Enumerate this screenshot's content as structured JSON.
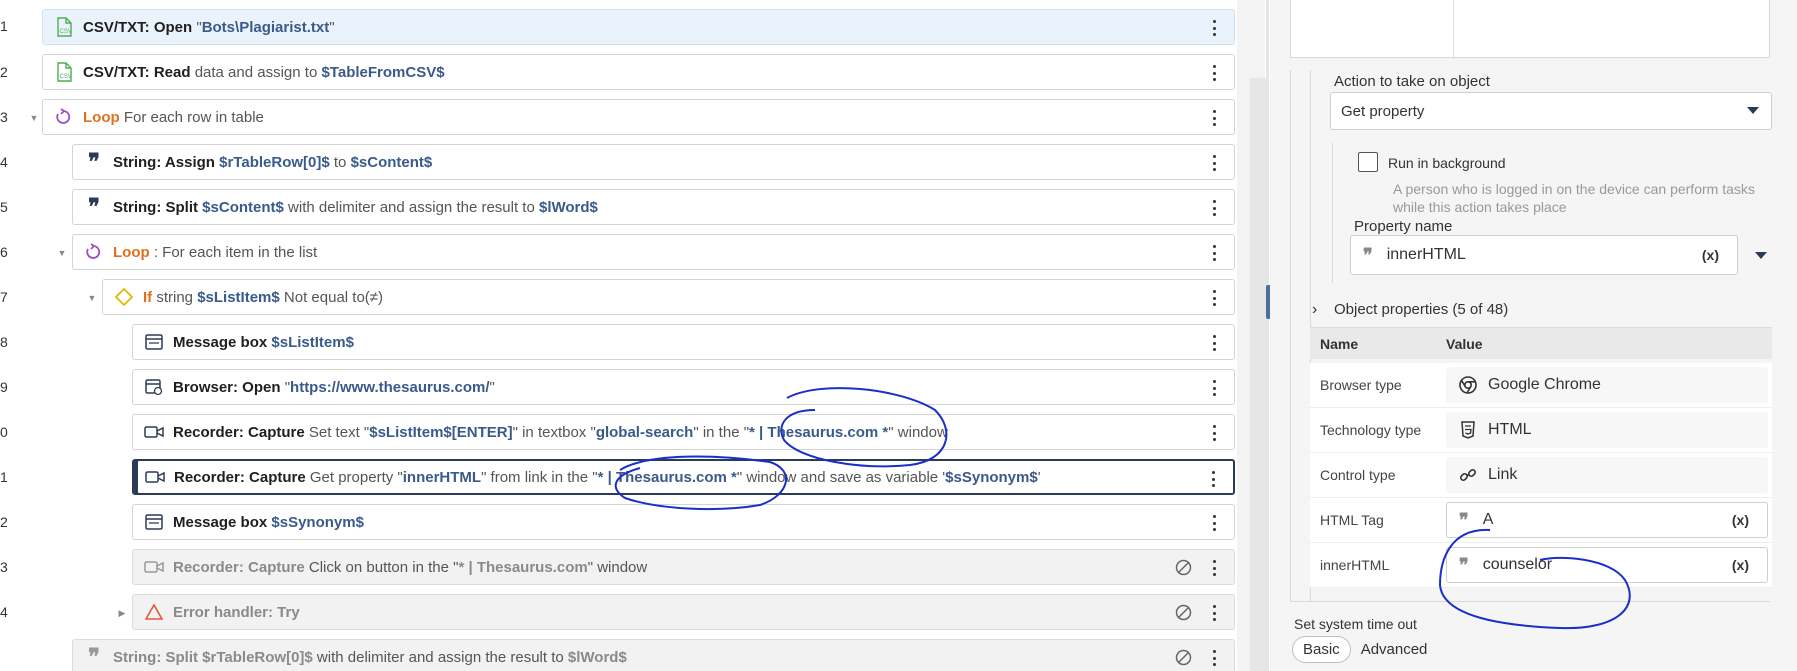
{
  "steps": [
    {
      "num": "1",
      "parts": [
        [
          "b",
          "CSV/TXT: Open"
        ],
        [
          "n",
          " \""
        ],
        [
          "v",
          "Bots\\Plagiarist.txt"
        ],
        [
          "n",
          "\""
        ]
      ]
    },
    {
      "num": "2",
      "parts": [
        [
          "b",
          "CSV/TXT: Read"
        ],
        [
          "n",
          " data and assign to "
        ],
        [
          "v",
          "$TableFromCSV$"
        ]
      ]
    },
    {
      "num": "3",
      "parts": [
        [
          "o",
          "Loop"
        ],
        [
          "n",
          " For each row in table"
        ]
      ]
    },
    {
      "num": "4",
      "parts": [
        [
          "b",
          "String: Assign"
        ],
        [
          "n",
          " "
        ],
        [
          "v",
          "$rTableRow[0]$"
        ],
        [
          "n",
          " to "
        ],
        [
          "v",
          "$sContent$"
        ]
      ]
    },
    {
      "num": "5",
      "parts": [
        [
          "b",
          "String: Split"
        ],
        [
          "n",
          " "
        ],
        [
          "v",
          "$sContent$"
        ],
        [
          "n",
          " with delimiter and assign the result to "
        ],
        [
          "v",
          "$lWord$"
        ]
      ]
    },
    {
      "num": "6",
      "parts": [
        [
          "o",
          "Loop"
        ],
        [
          "n",
          " : For each item in the list"
        ]
      ]
    },
    {
      "num": "7",
      "parts": [
        [
          "o",
          "If"
        ],
        [
          "n",
          " string "
        ],
        [
          "v",
          "$sListItem$"
        ],
        [
          "n",
          " Not equal to(≠)"
        ]
      ]
    },
    {
      "num": "8",
      "parts": [
        [
          "b",
          "Message box"
        ],
        [
          "n",
          " "
        ],
        [
          "v",
          "$sListItem$"
        ]
      ]
    },
    {
      "num": "9",
      "parts": [
        [
          "b",
          "Browser: Open"
        ],
        [
          "n",
          " \""
        ],
        [
          "v",
          "https://www.thesaurus.com/"
        ],
        [
          "n",
          "\""
        ]
      ]
    },
    {
      "num": "0",
      "parts": [
        [
          "b",
          "Recorder: Capture"
        ],
        [
          "n",
          " Set text \""
        ],
        [
          "v",
          "$sListItem$[ENTER]"
        ],
        [
          "n",
          "\" in textbox \""
        ],
        [
          "v",
          "global-search"
        ],
        [
          "n",
          "\" in the \""
        ],
        [
          "v",
          "* | Thesaurus.com *"
        ],
        [
          "n",
          "\" window"
        ]
      ]
    },
    {
      "num": "1",
      "parts": [
        [
          "b",
          "Recorder: Capture"
        ],
        [
          "n",
          " Get property \""
        ],
        [
          "v",
          "innerHTML"
        ],
        [
          "n",
          "\" from link in the \""
        ],
        [
          "v",
          "* | Thesaurus.com *"
        ],
        [
          "n",
          "\" window and save as variable '"
        ],
        [
          "v",
          "$sSynonym$"
        ],
        [
          "n",
          "'"
        ]
      ]
    },
    {
      "num": "2",
      "parts": [
        [
          "b",
          "Message box"
        ],
        [
          "n",
          " "
        ],
        [
          "v",
          "$sSynonym$"
        ]
      ]
    },
    {
      "num": "3",
      "parts": [
        [
          "b",
          "Recorder: Capture"
        ],
        [
          "n",
          " Click on button in the \""
        ],
        [
          "v",
          "* | Thesaurus.com"
        ],
        [
          "n",
          "\" window"
        ]
      ]
    },
    {
      "num": "4",
      "parts": [
        [
          "b",
          "Error handler: Try"
        ]
      ]
    },
    {
      "num": "",
      "parts": [
        [
          "b",
          "String: Split"
        ],
        [
          "n",
          " "
        ],
        [
          "v",
          "$rTableRow[0]$"
        ],
        [
          "n",
          " with delimiter and assign the result to "
        ],
        [
          "v",
          "$lWord$"
        ]
      ]
    }
  ],
  "props": {
    "action_label": "Action to take on object",
    "action_value": "Get property",
    "run_bg_label": "Run in background",
    "run_bg_desc": "A person who is logged in on the device can perform tasks while this action takes place",
    "property_name_label": "Property name",
    "property_name_value": "innerHTML",
    "var_btn": "(x)",
    "object_props_label": "Object properties (5 of 48)",
    "col_name": "Name",
    "col_value": "Value",
    "rows": [
      {
        "name": "Browser type",
        "value": "Google Chrome"
      },
      {
        "name": "Technology type",
        "value": "HTML"
      },
      {
        "name": "Control type",
        "value": "Link"
      },
      {
        "name": "HTML Tag",
        "value": "A"
      },
      {
        "name": "innerHTML",
        "value": "counselor"
      }
    ],
    "timeout_label": "Set system time out",
    "basic": "Basic",
    "advanced": "Advanced"
  },
  "colors": {
    "variable": "#3a5a8c",
    "keyword": "#e07020",
    "ink": "#1a2fc9"
  }
}
